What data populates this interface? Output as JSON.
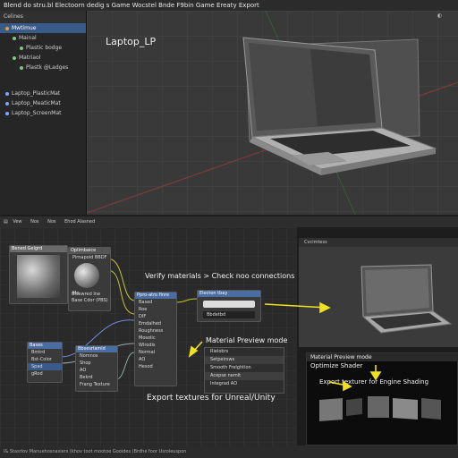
{
  "window": {
    "title": "Blend do stru.bl Electoorn dedig s Game Wocstel Bnde F9bin Game Ereaty Export"
  },
  "outliner": {
    "header": "Celines",
    "items": [
      {
        "label": "Mwtimue",
        "selected": true
      },
      {
        "label": "Mainal"
      },
      {
        "label": "Plastic bodge"
      },
      {
        "label": "Matriaol"
      },
      {
        "label": "Plastk @Ladges"
      },
      {
        "label": "Laptop_PlasticMat"
      },
      {
        "label": "Laptop_MeaticMat"
      },
      {
        "label": "Laptop_ScreenMat"
      }
    ]
  },
  "viewport": {
    "object_label": "Laptop_LP"
  },
  "node_editor": {
    "header_items": [
      "Vew",
      "Nos",
      "Nos",
      "Ehod Alasned"
    ],
    "nodes": {
      "texture": {
        "title": "Bened Gelgrd"
      },
      "mapping": {
        "title": "Oplimbaice",
        "rows": [
          "Pirnapoid BBDF",
          "Mo",
          "Bisewred Ine",
          "Base Cdor (PBS)"
        ]
      },
      "principled": {
        "title": "Ppro-atro finre",
        "rows": [
          "Based",
          "Roe",
          "DIF",
          "Emdalhed",
          "Roughness",
          "Mosolic",
          "Wlrodis",
          "Normal",
          "AO",
          "Hesod"
        ]
      },
      "output": {
        "title": "Electon tbay",
        "field": "Bbdetbd"
      },
      "inputs": {
        "title": "Bases",
        "rows": [
          "Bmtrd",
          "Bst-Color",
          "Spad",
          "gRod"
        ]
      },
      "bake": {
        "title": "Bbsesrlamld",
        "rows": [
          "Nomnos",
          "Shop",
          "AO",
          "Bekrd",
          "Frang Texture"
        ]
      }
    }
  },
  "annotations": {
    "verify": "Verify materials > Check noo connections",
    "material_preview": "Material Preview mode",
    "export": "Export textures for Unreal/Unity"
  },
  "material_menu": [
    "Rielobrs",
    "Setpeirsws",
    "Smooth Frelghtlon",
    "Acepse nemlt",
    "Integrad AO"
  ],
  "right_panel": {
    "header": "Cvcimtess",
    "mode_label": "Material Preview mode",
    "optimize_label": "Optimize Shader",
    "export_label": "Export texturer for Engine Shading"
  },
  "status_bar": {
    "text": "l& Stasrlov Manuehosnasiers (khov toot mootoe Gooides (Brdhe foor Usroleuspon"
  },
  "colors": {
    "accent": "#f0e020",
    "selection": "#3a5a8a",
    "node_header_blue": "#4a6ea3"
  }
}
